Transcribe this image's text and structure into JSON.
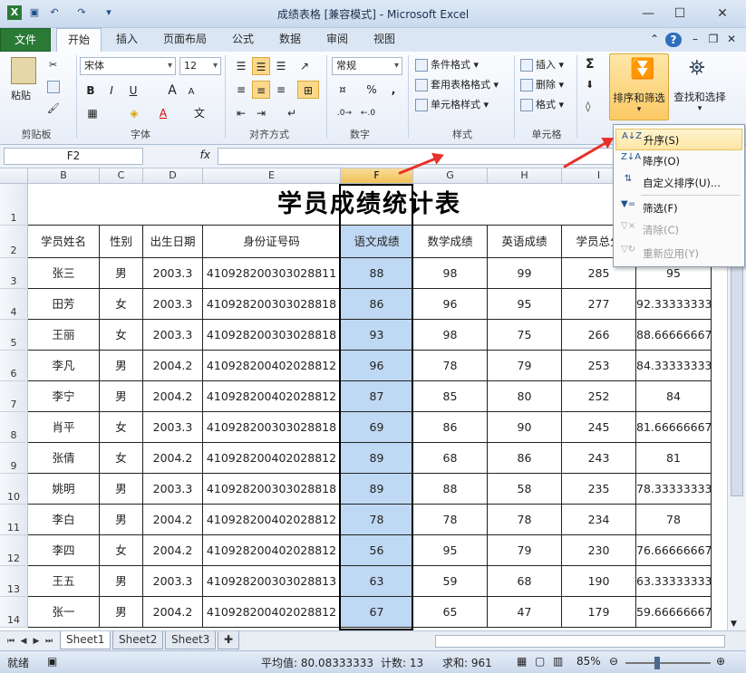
{
  "window": {
    "title": "成绩表格  [兼容模式] - Microsoft Excel"
  },
  "ribbon_tabs": [
    "文件",
    "开始",
    "插入",
    "页面布局",
    "公式",
    "数据",
    "审阅",
    "视图"
  ],
  "clipboard": {
    "paste": "粘贴",
    "label": "剪贴板"
  },
  "font": {
    "name": "宋体",
    "size": "12",
    "bold": "B",
    "italic": "I",
    "underline": "U",
    "grow": "A",
    "shrink": "A",
    "color_a": "A",
    "phonetic": "文",
    "label": "字体"
  },
  "alignment": {
    "label": "对齐方式"
  },
  "number": {
    "format": "常规",
    "percent": "%",
    "comma": ",",
    "label": "数字"
  },
  "styles": {
    "conditional": "条件格式",
    "table": "套用表格格式",
    "cell": "单元格样式",
    "label": "样式"
  },
  "cells": {
    "insert": "插入",
    "delete": "删除",
    "format": "格式",
    "label": "单元格"
  },
  "editing": {
    "sum": "Σ",
    "sort_filter": "排序和筛选",
    "find_select": "查找和选择"
  },
  "namebox": "F2",
  "fx": "fx",
  "columns": [
    "B",
    "C",
    "D",
    "E",
    "F",
    "G",
    "H",
    "I"
  ],
  "rows": [
    "1",
    "2",
    "3",
    "4",
    "5",
    "6",
    "7",
    "8",
    "9",
    "10",
    "11",
    "12",
    "13",
    "14"
  ],
  "sheet_title": "学员成绩统计表",
  "headers": [
    "学员姓名",
    "性别",
    "出生日期",
    "身份证号码",
    "语文成绩",
    "数学成绩",
    "英语成绩",
    "学员总分",
    ""
  ],
  "data": [
    [
      "张三",
      "男",
      "2003.3",
      "410928200303028811",
      "88",
      "98",
      "99",
      "285",
      "95"
    ],
    [
      "田芳",
      "女",
      "2003.3",
      "410928200303028818",
      "86",
      "96",
      "95",
      "277",
      "92.33333333"
    ],
    [
      "王丽",
      "女",
      "2003.3",
      "410928200303028818",
      "93",
      "98",
      "75",
      "266",
      "88.66666667"
    ],
    [
      "李凡",
      "男",
      "2004.2",
      "410928200402028812",
      "96",
      "78",
      "79",
      "253",
      "84.33333333"
    ],
    [
      "李宁",
      "男",
      "2004.2",
      "410928200402028812",
      "87",
      "85",
      "80",
      "252",
      "84"
    ],
    [
      "肖平",
      "女",
      "2003.3",
      "410928200303028818",
      "69",
      "86",
      "90",
      "245",
      "81.66666667"
    ],
    [
      "张倩",
      "女",
      "2004.2",
      "410928200402028812",
      "89",
      "68",
      "86",
      "243",
      "81"
    ],
    [
      "姚明",
      "男",
      "2003.3",
      "410928200303028818",
      "89",
      "88",
      "58",
      "235",
      "78.33333333"
    ],
    [
      "李白",
      "男",
      "2004.2",
      "410928200402028812",
      "78",
      "78",
      "78",
      "234",
      "78"
    ],
    [
      "李四",
      "女",
      "2004.2",
      "410928200402028812",
      "56",
      "95",
      "79",
      "230",
      "76.66666667"
    ],
    [
      "王五",
      "男",
      "2003.3",
      "410928200303028813",
      "63",
      "59",
      "68",
      "190",
      "63.33333333"
    ],
    [
      "张一",
      "男",
      "2004.2",
      "410928200402028812",
      "67",
      "65",
      "47",
      "179",
      "59.66666667"
    ]
  ],
  "sort_menu": [
    {
      "label": "升序(S)",
      "icon": "sort-ascending-icon",
      "disabled": false,
      "highlighted": true
    },
    {
      "label": "降序(O)",
      "icon": "sort-descending-icon",
      "disabled": false,
      "highlighted": false
    },
    {
      "label": "自定义排序(U)...",
      "icon": "custom-sort-icon",
      "disabled": false,
      "highlighted": false
    },
    {
      "label": "筛选(F)",
      "icon": "filter-icon",
      "disabled": false,
      "highlighted": false
    },
    {
      "label": "清除(C)",
      "icon": "clear-filter-icon",
      "disabled": true,
      "highlighted": false
    },
    {
      "label": "重新应用(Y)",
      "icon": "reapply-icon",
      "disabled": true,
      "highlighted": false
    }
  ],
  "sheets": [
    "Sheet1",
    "Sheet2",
    "Sheet3"
  ],
  "status": {
    "ready": "就绪",
    "average": "平均值: 80.08333333",
    "count": "计数: 13",
    "sum": "求和: 961",
    "zoom": "85%"
  },
  "colors": {
    "selection": "#bfd8f3",
    "file_tab": "#2a7a36",
    "arrow": "#e8312a"
  }
}
